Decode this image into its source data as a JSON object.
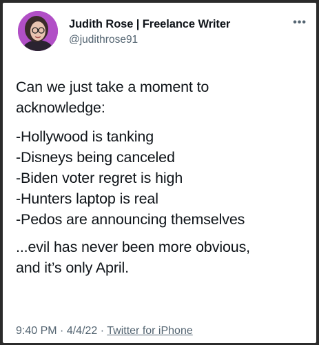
{
  "tweet": {
    "author_name": "Judith Rose | Freelance Writer",
    "handle": "@judithrose91",
    "more_icon": "more-horizontal-icon",
    "text_intro": [
      "Can we just take a moment to",
      "acknowledge:"
    ],
    "text_list": [
      "-Hollywood is tanking",
      "-Disneys being canceled",
      "-Biden voter regret is high",
      "-Hunters laptop is real",
      "-Pedos are announcing themselves"
    ],
    "text_outro": [
      "...evil has never been more obvious,",
      "and it’s only April."
    ],
    "time": "9:40 PM",
    "date": "4/4/22",
    "separator": "·",
    "source": "Twitter for iPhone"
  },
  "colors": {
    "text": "#0f1419",
    "secondary": "#536471",
    "avatar_bg": "#b14fc6"
  }
}
